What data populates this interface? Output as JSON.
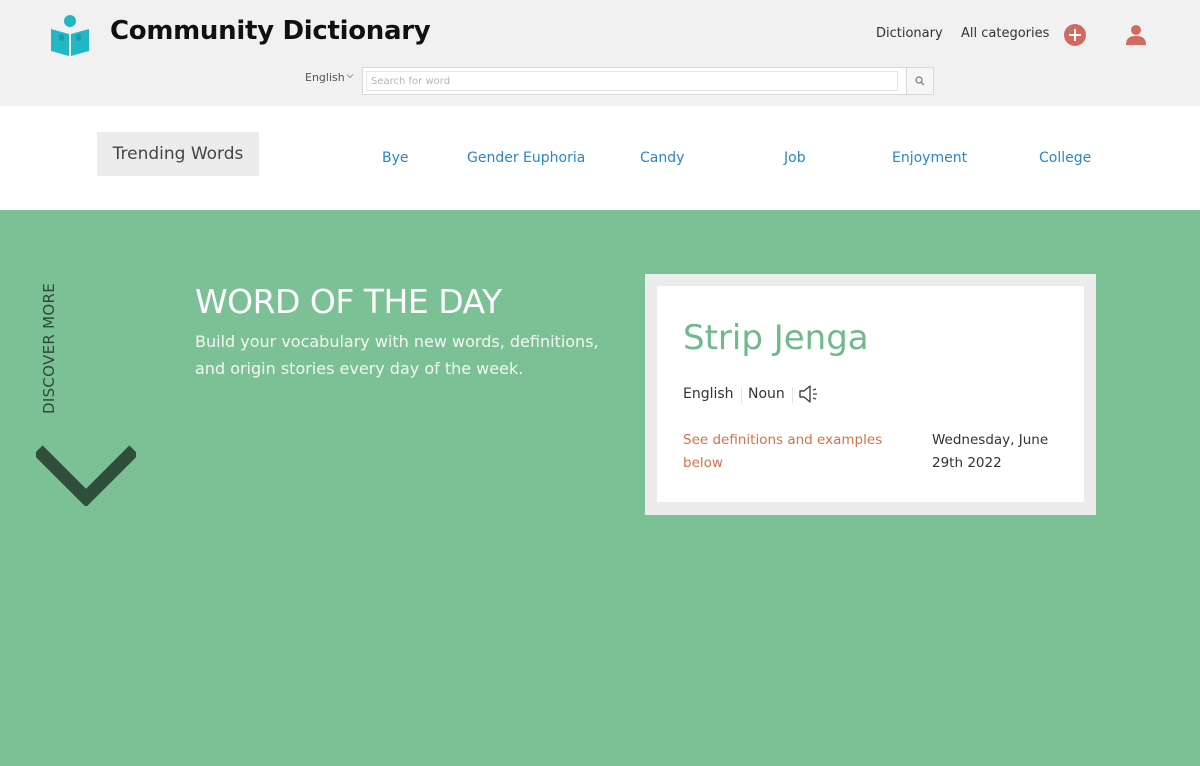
{
  "header": {
    "brand": "Community Dictionary",
    "nav": {
      "dictionary": "Dictionary",
      "categories": "All categories"
    },
    "language": "English",
    "search": {
      "placeholder": "Search for word",
      "value": ""
    }
  },
  "trending": {
    "label": "Trending Words",
    "words": [
      "Bye",
      "Gender Euphoria",
      "Candy",
      "Job",
      "Enjoyment",
      "College"
    ]
  },
  "hero": {
    "discover": "DISCOVER MORE",
    "title": "WORD OF THE DAY",
    "description": "Build your vocabulary with new words, definitions, and origin stories every day of the week."
  },
  "wotd_card": {
    "word": "Strip Jenga",
    "language": "English",
    "part_of_speech": "Noun",
    "link": "See definitions and examples below",
    "date": "Wednesday, June 29th 2022"
  },
  "colors": {
    "brand_teal": "#23b7c6",
    "hero_green": "#7cc095",
    "link_blue": "#2b86c7",
    "accent_orange": "#d3714a",
    "add_red": "#d06a63"
  }
}
